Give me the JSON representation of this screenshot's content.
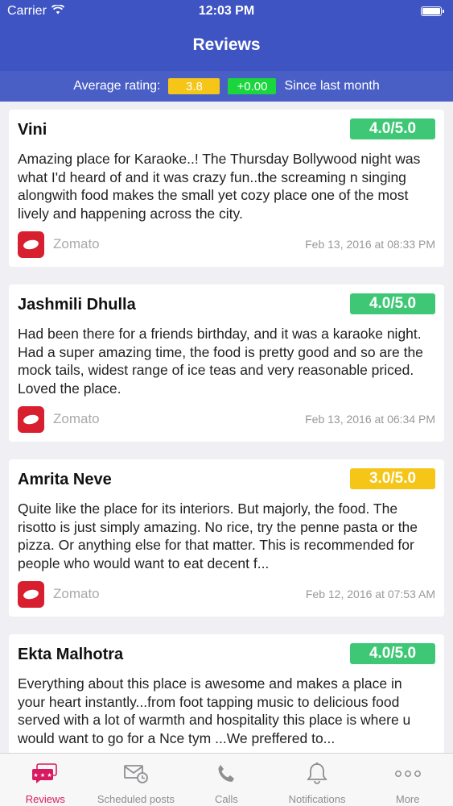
{
  "status_bar": {
    "carrier": "Carrier",
    "time": "12:03 PM"
  },
  "header": {
    "title": "Reviews"
  },
  "rating_summary": {
    "label": "Average rating:",
    "average": "3.8",
    "change": "+0.00",
    "suffix": "Since last month"
  },
  "reviews": [
    {
      "name": "Vini",
      "score": "4.0/5.0",
      "text": "Amazing place for Karaoke..! The Thursday Bollywood night was what I'd heard of and it was crazy fun..the screaming n singing alongwith food makes the small yet cozy place  one of the most lively and happening across the city.",
      "source": "Zomato",
      "timestamp": "Feb 13, 2016 at 08:33 PM"
    },
    {
      "name": "Jashmili Dhulla",
      "score": "4.0/5.0",
      "text": "Had been there for a friends birthday, and it was a karaoke night. Had a super amazing time, the food is pretty good and so are the mock tails, widest range of ice teas and very reasonable priced. Loved the place.",
      "source": "Zomato",
      "timestamp": "Feb 13, 2016 at 06:34 PM"
    },
    {
      "name": "Amrita Neve",
      "score": "3.0/5.0",
      "text": "Quite like the place for its interiors. But majorly, the food. The risotto is just simply amazing. No rice, try the penne pasta or the pizza. Or anything else for that matter. This is recommended for people who would want to eat decent f...",
      "source": "Zomato",
      "timestamp": "Feb 12, 2016 at 07:53 AM"
    },
    {
      "name": "Ekta Malhotra",
      "score": "4.0/5.0",
      "text": "Everything about this place is awesome and makes a place in your heart instantly...from foot tapping music to delicious food served with a lot of warmth and hospitality this place is where u would want to go for a Nce tym ...We preffered to..."
    }
  ],
  "tabs": [
    {
      "label": "Reviews",
      "icon": "reviews-icon",
      "active": true
    },
    {
      "label": "Scheduled posts",
      "icon": "scheduled-icon"
    },
    {
      "label": "Calls",
      "icon": "phone-icon"
    },
    {
      "label": "Notifications",
      "icon": "bell-icon"
    },
    {
      "label": "More",
      "icon": "more-icon"
    }
  ],
  "colors": {
    "header": "#3e54c3",
    "rating_bar": "#4a5fc6",
    "green": "#3ec876",
    "yellow": "#f5c518",
    "accent": "#d81b60",
    "zomato": "#d81f2f"
  }
}
